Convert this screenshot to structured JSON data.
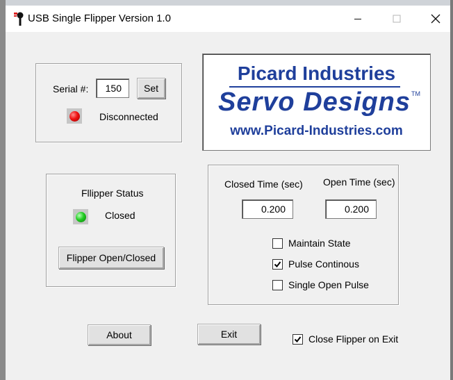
{
  "window": {
    "title": "USB Single Flipper Version 1.0",
    "controls": {
      "minimize": "minimize",
      "maximize": "maximize",
      "close": "close"
    }
  },
  "serial_group": {
    "label": "Serial #:",
    "value": "150",
    "set_label": "Set",
    "status_text": "Disconnected",
    "status_color": "#ee1111"
  },
  "logo": {
    "company": "Picard Industries",
    "brand_part1": "Servo",
    "brand_part2": "Designs",
    "trademark": "TM",
    "website": "www.Picard-Industries.com",
    "color": "#1f3f9b"
  },
  "flipper_group": {
    "heading": "Fllipper Status",
    "state_text": "Closed",
    "state_color": "#22cc22",
    "toggle_label": "Flipper Open/Closed"
  },
  "timing_group": {
    "closed_time_label": "Closed Time (sec)",
    "closed_time_value": "0.200",
    "open_time_label": "Open Time (sec)",
    "open_time_value": "0.200",
    "options": [
      {
        "label": "Maintain State",
        "checked": false
      },
      {
        "label": "Pulse Continous",
        "checked": true
      },
      {
        "label": "Single Open Pulse",
        "checked": false
      }
    ]
  },
  "footer": {
    "about_label": "About",
    "exit_label": "Exit",
    "close_on_exit_label": "Close Flipper on Exit",
    "close_on_exit_checked": true
  }
}
